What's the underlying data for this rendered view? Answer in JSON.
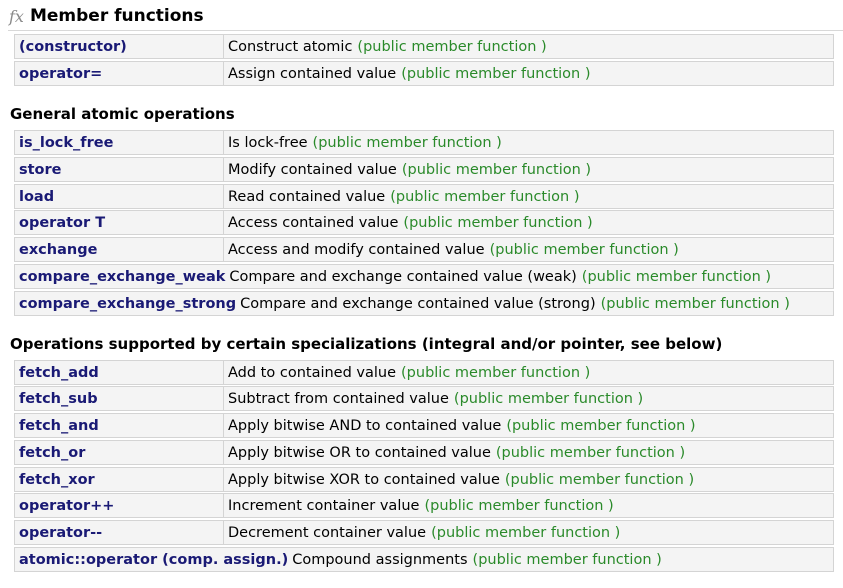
{
  "header": {
    "icon": "fx-icon",
    "title": "Member functions"
  },
  "kind_label": "(public member function )",
  "sections": [
    {
      "title": "",
      "rows": [
        {
          "name": "(constructor)",
          "desc": "Construct atomic"
        },
        {
          "name": "operator=",
          "desc": "Assign contained value"
        }
      ]
    },
    {
      "title": "General atomic operations",
      "rows": [
        {
          "name": "is_lock_free",
          "desc": "Is lock-free"
        },
        {
          "name": "store",
          "desc": "Modify contained value"
        },
        {
          "name": "load",
          "desc": "Read contained value"
        },
        {
          "name": "operator T",
          "desc": "Access contained value"
        },
        {
          "name": "exchange",
          "desc": "Access and modify contained value"
        },
        {
          "name": "compare_exchange_weak",
          "desc": "Compare and exchange contained value (weak)"
        },
        {
          "name": "compare_exchange_strong",
          "desc": "Compare and exchange contained value (strong)"
        }
      ]
    },
    {
      "title": "Operations supported by certain specializations (integral and/or pointer, see below)",
      "rows": [
        {
          "name": "fetch_add",
          "desc": "Add to contained value"
        },
        {
          "name": "fetch_sub",
          "desc": "Subtract from contained value"
        },
        {
          "name": "fetch_and",
          "desc": "Apply bitwise AND to contained value"
        },
        {
          "name": "fetch_or",
          "desc": "Apply bitwise OR to contained value"
        },
        {
          "name": "fetch_xor",
          "desc": "Apply bitwise XOR to contained value"
        },
        {
          "name": "operator++",
          "desc": "Increment container value"
        },
        {
          "name": "operator--",
          "desc": "Decrement container value"
        },
        {
          "name": "atomic::operator (comp. assign.)",
          "desc": "Compound assignments"
        }
      ]
    }
  ]
}
